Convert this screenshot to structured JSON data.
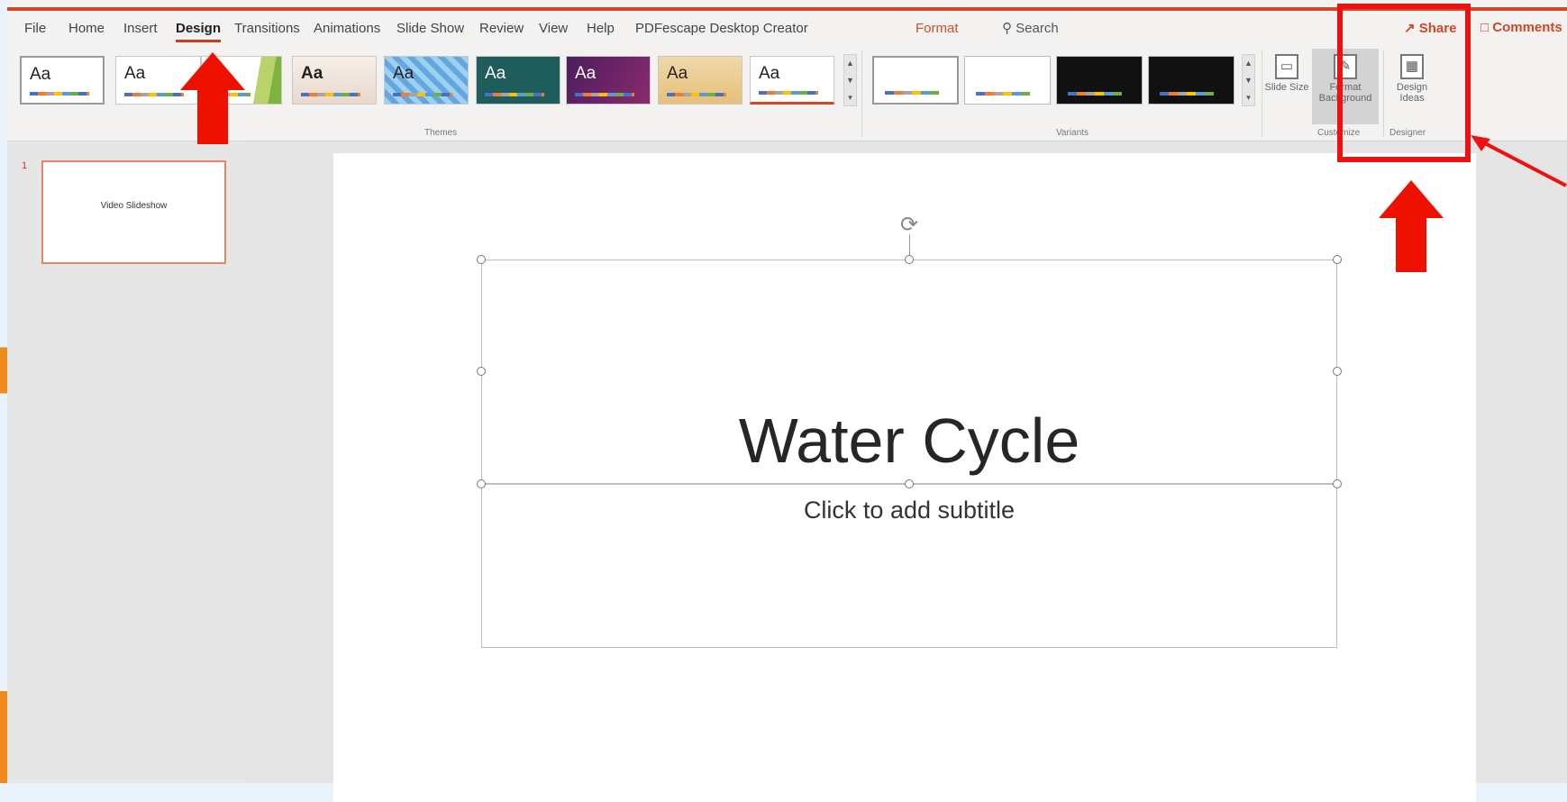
{
  "menu": {
    "tabs": [
      {
        "label": "File"
      },
      {
        "label": "Home"
      },
      {
        "label": "Insert"
      },
      {
        "label": "Design"
      },
      {
        "label": "Transitions"
      },
      {
        "label": "Animations"
      },
      {
        "label": "Slide Show"
      },
      {
        "label": "Review"
      },
      {
        "label": "View"
      },
      {
        "label": "Help"
      },
      {
        "label": "PDFescape Desktop Creator"
      },
      {
        "label": "Format"
      }
    ],
    "active_tab": "Design",
    "search_label": "Search",
    "share_label": "Share",
    "comments_label": "Comments"
  },
  "ribbon": {
    "themes_label": "Themes",
    "theme_sample": "Aa",
    "variants_label": "Variants",
    "customize_label": "Customize",
    "designer_label": "Designer",
    "slide_size_label": "Slide Size",
    "format_background_label": "Format Background",
    "design_ideas_label": "Design Ideas"
  },
  "slides_panel": {
    "slide_number": "1",
    "thumb_text": "Video Slideshow"
  },
  "slide": {
    "title": "Water Cycle",
    "subtitle_placeholder": "Click to add subtitle"
  },
  "colors": {
    "accent": "#d24726",
    "annotation": "#ee1111"
  }
}
